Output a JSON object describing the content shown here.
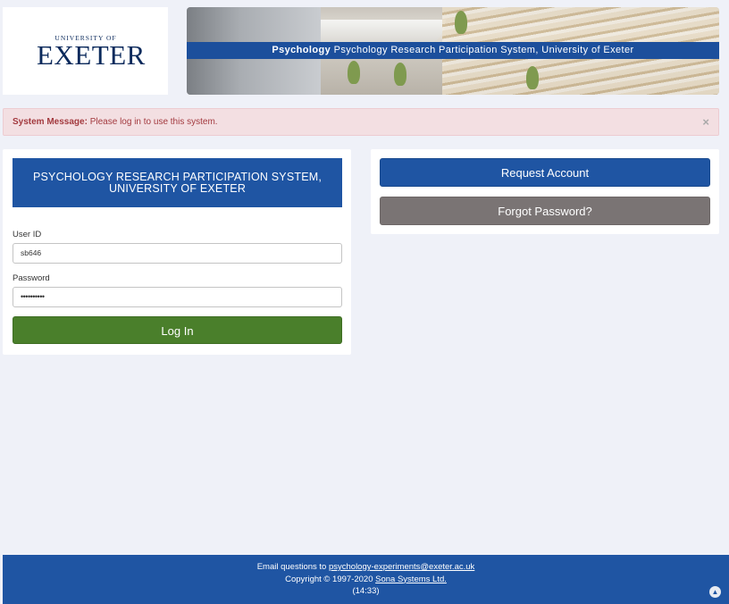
{
  "logo": {
    "line1": "UNIVERSITY OF",
    "line2": "EXETER"
  },
  "banner": {
    "bold": "Psychology",
    "text": "Psychology Research Participation System, University of Exeter"
  },
  "alert": {
    "label": "System Message:",
    "text": "Please log in to use this system.",
    "close": "×"
  },
  "login_card": {
    "title_line1": "PSYCHOLOGY RESEARCH PARTICIPATION SYSTEM,",
    "title_line2": "UNIVERSITY OF EXETER",
    "user_label": "User ID",
    "user_value": "sb646",
    "password_label": "Password",
    "password_value": "••••••••••",
    "login_button": "Log In"
  },
  "account_card": {
    "request_button": "Request Account",
    "forgot_button": "Forgot Password?"
  },
  "footer": {
    "email_prefix": "Email questions to ",
    "email": "psychology-experiments@exeter.ac.uk",
    "copyright_prefix": "Copyright © 1997-2020 ",
    "company": "Sona Systems Ltd.",
    "time": "(14:33)"
  },
  "colors": {
    "brand_blue": "#1f55a3",
    "login_green": "#4a7f2b",
    "forgot_gray": "#7a7474",
    "alert_bg": "#f3dfe2",
    "alert_text": "#a33a3f"
  },
  "icons": {
    "close": "close-icon",
    "scroll_top": "chevron-up-icon"
  }
}
